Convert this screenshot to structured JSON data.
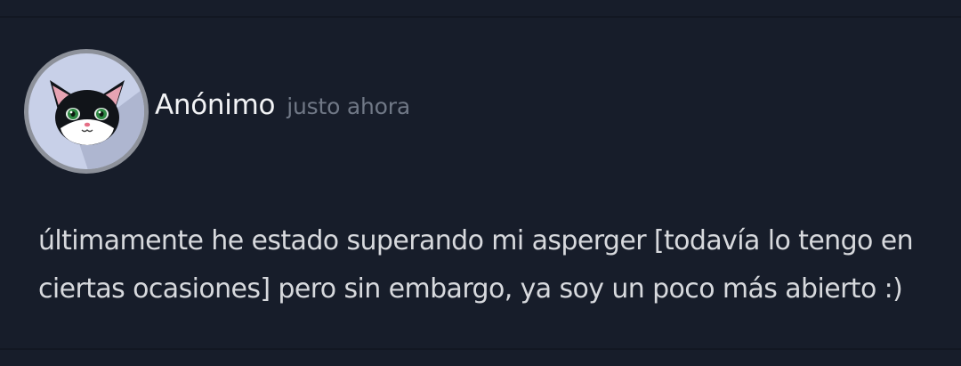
{
  "comment": {
    "author": "Anónimo",
    "timestamp": "justo ahora",
    "avatar_icon": "cat-avatar-icon",
    "text_line_1": "últimamente he estado superando mi asperger [todavía lo tengo en",
    "text_line_2": "ciertas ocasiones] pero sin embargo, ya soy un poco más abierto :)"
  },
  "colors": {
    "background": "#171d2a",
    "divider": "#121722",
    "author_text": "#f2f3f5",
    "timestamp_text": "#707886",
    "body_text": "#d7d9dd",
    "avatar_ring": "#8d919a",
    "avatar_bg": "#c8d0e8"
  }
}
